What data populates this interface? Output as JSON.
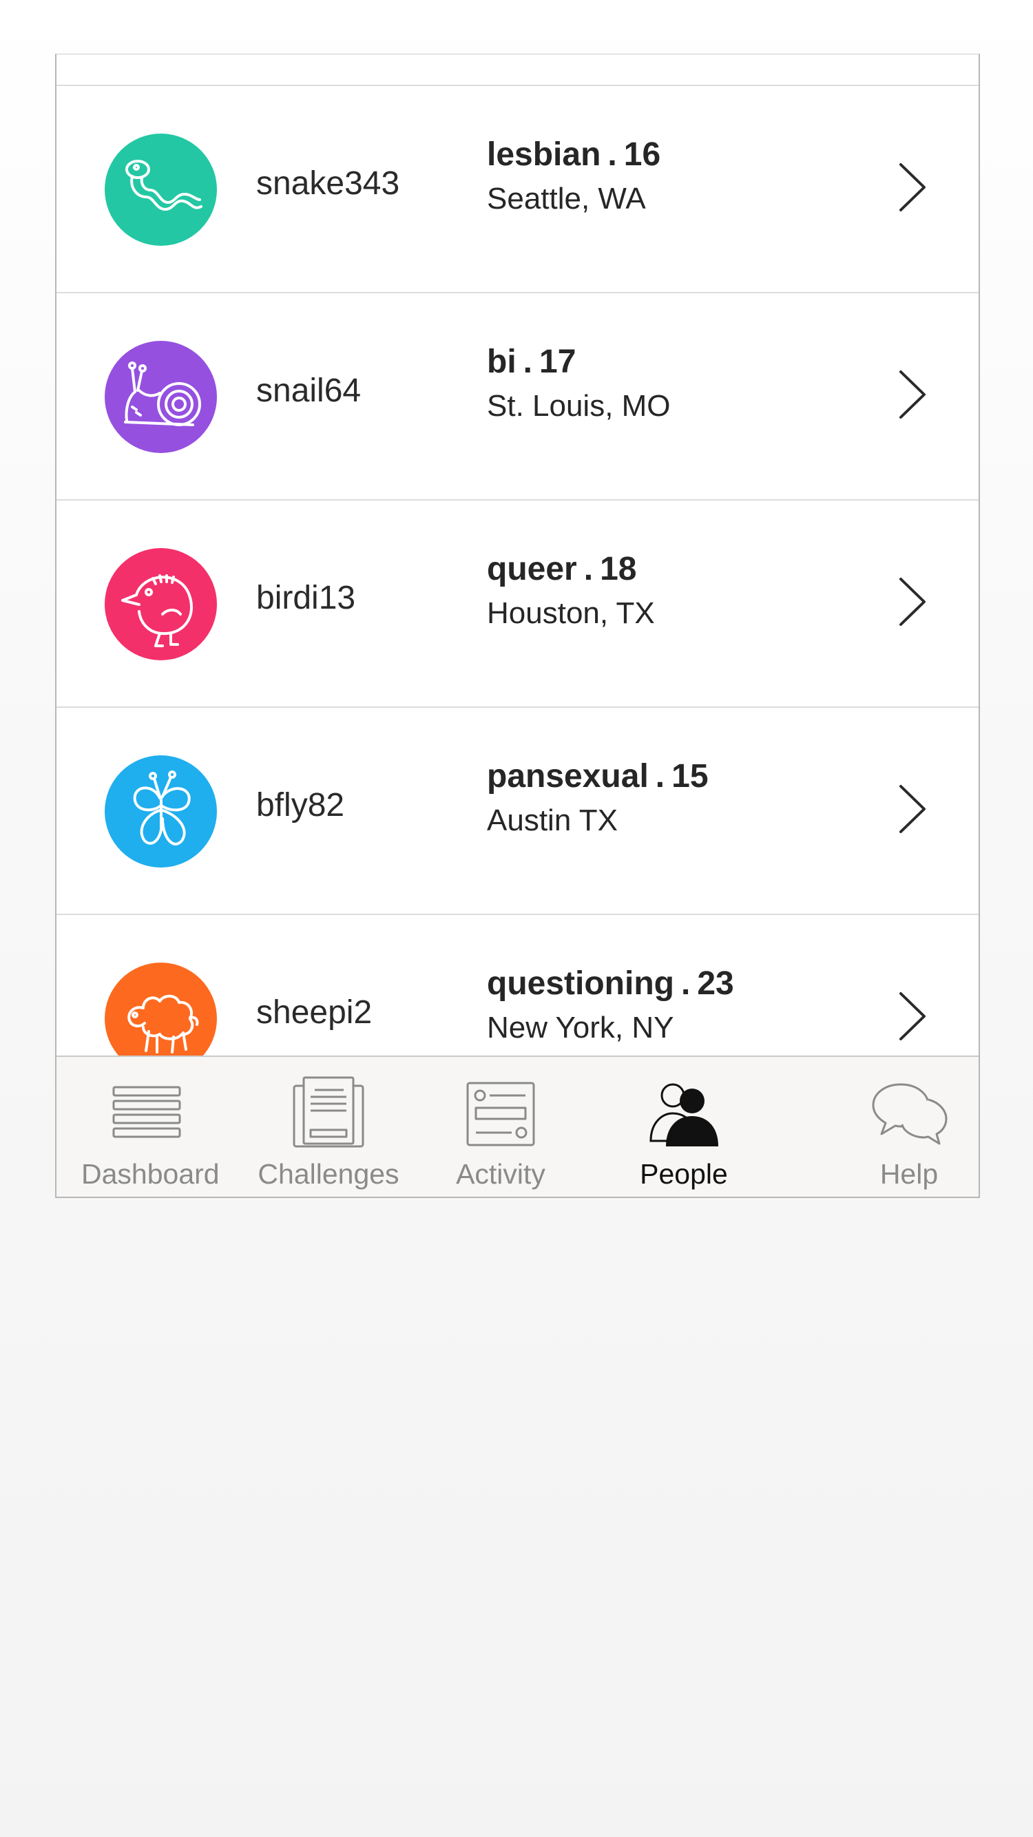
{
  "people": [
    {
      "username": "snake343",
      "identity": "lesbian",
      "age": "16",
      "location": "Seattle, WA",
      "avatar_icon": "snake-icon",
      "avatar_color": "#23c7a4"
    },
    {
      "username": "snail64",
      "identity": "bi",
      "age": "17",
      "location": "St. Louis, MO",
      "avatar_icon": "snail-icon",
      "avatar_color": "#9550e0"
    },
    {
      "username": "birdi13",
      "identity": "queer",
      "age": "18",
      "location": "Houston, TX",
      "avatar_icon": "bird-icon",
      "avatar_color": "#f4306b"
    },
    {
      "username": "bfly82",
      "identity": "pansexual",
      "age": "15",
      "location": "Austin TX",
      "avatar_icon": "butterfly-icon",
      "avatar_color": "#1faeee"
    },
    {
      "username": "sheepi2",
      "identity": "questioning",
      "age": "23",
      "location": "New York, NY",
      "avatar_icon": "sheep-icon",
      "avatar_color": "#fd6a1f"
    }
  ],
  "separator": ".",
  "tabs": [
    {
      "label": "Dashboard",
      "icon": "dashboard-icon",
      "active": false
    },
    {
      "label": "Challenges",
      "icon": "challenges-icon",
      "active": false
    },
    {
      "label": "Activity",
      "icon": "activity-icon",
      "active": false
    },
    {
      "label": "People",
      "icon": "people-icon",
      "active": true
    },
    {
      "label": "Help",
      "icon": "help-icon",
      "active": false
    }
  ],
  "colors": {
    "tab_inactive": "#8a8a8a",
    "tab_active": "#111111",
    "divider": "#dcdcdc"
  }
}
